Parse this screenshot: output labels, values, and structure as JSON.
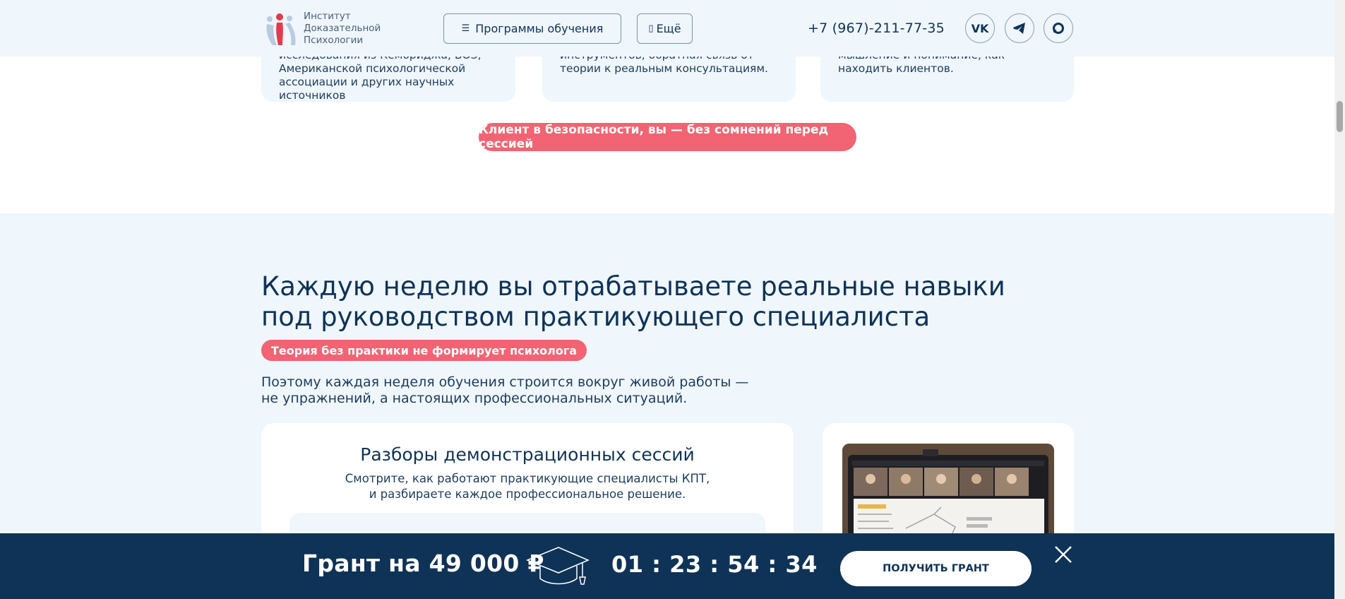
{
  "header": {
    "logo_text": [
      "Институт",
      "Доказательной",
      "Психологии"
    ],
    "programs_label": "Программы обучения",
    "more_label": "Ещё",
    "phone": "+7 (967)-211-77-35",
    "socials": [
      "vk-icon",
      "telegram-icon",
      "max-icon"
    ]
  },
  "top_cards": [
    {
      "text": "исследования из Кембриджа, ВОЗ, Американской психологической ассоциации и других научных источников"
    },
    {
      "text": "инструментов, обратная связь от теории к реальным консультациям."
    },
    {
      "text": "мышление и понимание, как находить клиентов."
    }
  ],
  "top_pill": "Клиент в безопасности, вы — без сомнений перед сессией",
  "section": {
    "title_line1": "Каждую неделю вы отрабатываете реальные навыки",
    "title_line2": "под руководством практикующего специалиста",
    "badge": "Теория без практики не формирует психолога",
    "lead_line1": "Поэтому каждая неделя обучения строится вокруг живой работы —",
    "lead_line2": "не упражнений, а настоящих профессиональных ситуаций.",
    "card": {
      "title": "Разборы демонстрационных сессий",
      "desc_line1": "Смотрите, как работают практикующие специалисты КПТ,",
      "desc_line2": "и разбираете каждое профессиональное решение."
    }
  },
  "grant_bar": {
    "title": "Грант на 49 000 ₽",
    "timer": "01 : 23 : 54 : 34",
    "button_label": "ПОЛУЧИТЬ ГРАНТ"
  },
  "colors": {
    "brand_navy": "#0f3357",
    "accent_pink": "#f26473",
    "light_bg": "#eff6fc"
  }
}
